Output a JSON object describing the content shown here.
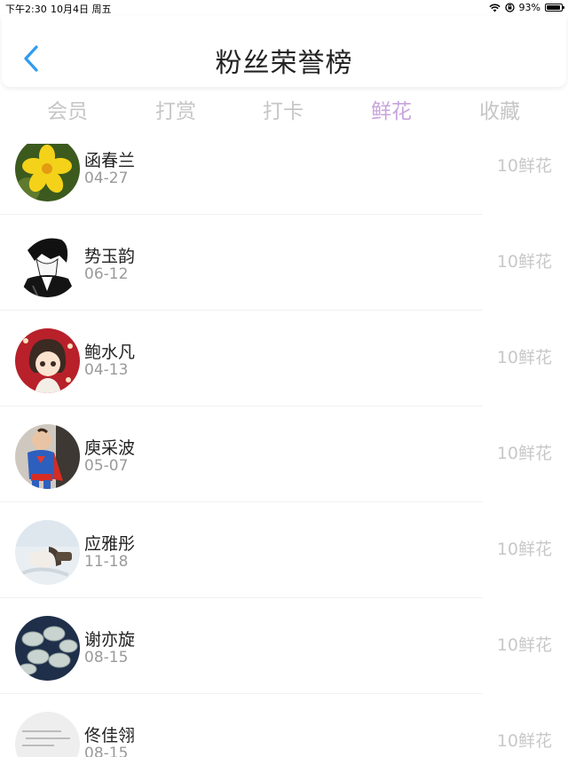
{
  "status_bar": {
    "time": "下午2:30",
    "date": "10月4日 周五",
    "battery": "93%",
    "battery_level": 0.93
  },
  "nav": {
    "title": "粉丝荣誉榜"
  },
  "tabs": [
    {
      "label": "会员",
      "active": false
    },
    {
      "label": "打赏",
      "active": false
    },
    {
      "label": "打卡",
      "active": false
    },
    {
      "label": "鲜花",
      "active": true
    },
    {
      "label": "收藏",
      "active": false
    }
  ],
  "colors": {
    "accent": "#c9a3dc",
    "back_icon": "#2e9bf0",
    "muted": "#c8c8c8"
  },
  "list": [
    {
      "name": "函春兰",
      "date": "04-27",
      "reward": "10鲜花",
      "avatar": "yellow-flower"
    },
    {
      "name": "势玉韵",
      "date": "06-12",
      "reward": "10鲜花",
      "avatar": "manga-boy"
    },
    {
      "name": "鲍水凡",
      "date": "04-13",
      "reward": "10鲜花",
      "avatar": "cartoon-girl"
    },
    {
      "name": "庾采波",
      "date": "05-07",
      "reward": "10鲜花",
      "avatar": "baby-superman"
    },
    {
      "name": "应雅彤",
      "date": "11-18",
      "reward": "10鲜花",
      "avatar": "pale-photo"
    },
    {
      "name": "谢亦旋",
      "date": "08-15",
      "reward": "10鲜花",
      "avatar": "dumplings"
    },
    {
      "name": "佟佳翎",
      "date": "08-15",
      "reward": "10鲜花",
      "avatar": "handwritten-note"
    }
  ]
}
